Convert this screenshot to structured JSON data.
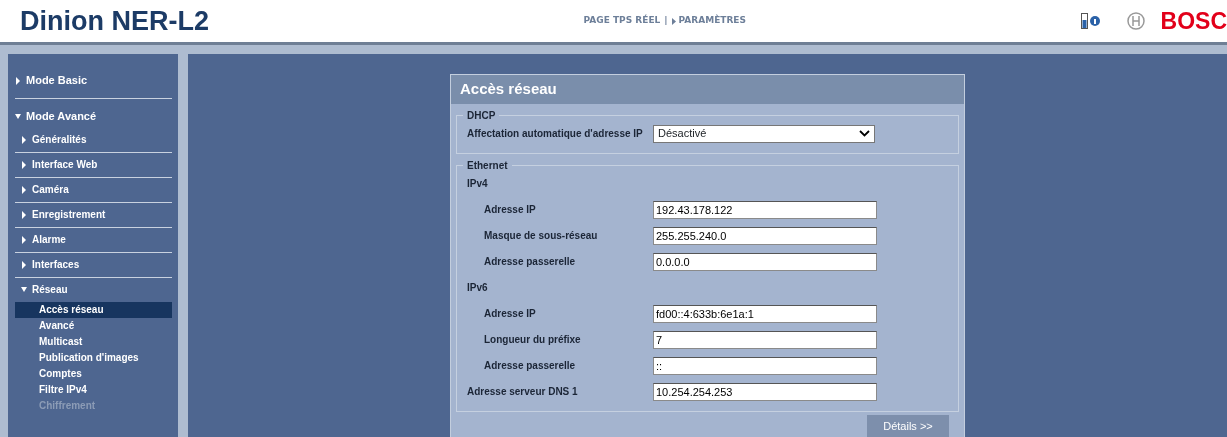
{
  "header": {
    "title": "Dinion NER-L2",
    "nav": [
      {
        "kind": "link",
        "label": "PAGE TPS RÉEL",
        "arrow": false
      },
      {
        "label": "|",
        "kind": "separator"
      },
      {
        "kind": "link",
        "label": "PARAMÈTRES",
        "arrow": true
      }
    ],
    "logo_text": "BOSC"
  },
  "sidebar": {
    "items": [
      {
        "label": "Mode Basic",
        "expanded": false
      },
      {
        "label": "Mode Avancé",
        "expanded": true,
        "children": [
          {
            "label": "Généralités",
            "expanded": false
          },
          {
            "label": "Interface Web",
            "expanded": false
          },
          {
            "label": "Caméra",
            "expanded": false
          },
          {
            "label": "Enregistrement",
            "expanded": false
          },
          {
            "label": "Alarme",
            "expanded": false
          },
          {
            "label": "Interfaces",
            "expanded": false
          },
          {
            "label": "Réseau",
            "expanded": true,
            "children": [
              {
                "label": "Accès réseau",
                "selected": true,
                "disabled": false
              },
              {
                "label": "Avancé",
                "selected": false,
                "disabled": false
              },
              {
                "label": "Multicast",
                "selected": false,
                "disabled": false
              },
              {
                "label": "Publication d'images",
                "selected": false,
                "disabled": false
              },
              {
                "label": "Comptes",
                "selected": false,
                "disabled": false
              },
              {
                "label": "Filtre IPv4",
                "selected": false,
                "disabled": false
              },
              {
                "label": "Chiffrement",
                "selected": false,
                "disabled": true
              }
            ]
          }
        ]
      }
    ]
  },
  "panel": {
    "title": "Accès réseau",
    "groups": [
      {
        "legend": "DHCP",
        "items": [
          {
            "kind": "select",
            "label": "Affectation automatique d'adresse IP",
            "value": "Désactivé"
          }
        ]
      },
      {
        "legend": "Ethernet",
        "items": [
          {
            "kind": "heading",
            "label": "IPv4",
            "children": [
              {
                "kind": "input",
                "label": "Adresse IP",
                "value": "192.43.178.122"
              },
              {
                "kind": "input",
                "label": "Masque de sous-réseau",
                "value": "255.255.240.0"
              },
              {
                "kind": "input",
                "label": "Adresse passerelle",
                "value": "0.0.0.0"
              }
            ]
          },
          {
            "kind": "heading",
            "label": "IPv6",
            "children": [
              {
                "kind": "input",
                "label": "Adresse IP",
                "value": "fd00::4:633b:6e1a:1"
              },
              {
                "kind": "input",
                "label": "Longueur du préfixe",
                "value": "7"
              },
              {
                "kind": "input",
                "label": "Adresse passerelle",
                "value": "::"
              }
            ]
          },
          {
            "kind": "input",
            "label": "Adresse serveur DNS 1",
            "value": "10.254.254.253"
          }
        ]
      }
    ],
    "button": "Détails >>"
  }
}
